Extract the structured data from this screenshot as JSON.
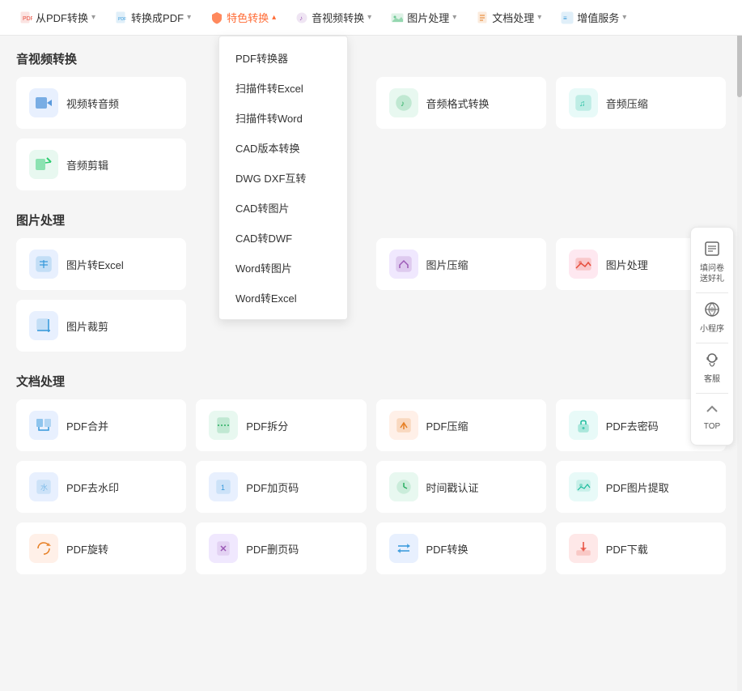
{
  "nav": {
    "items": [
      {
        "id": "from-pdf",
        "label": "从PDF转换",
        "icon": "📄",
        "hasArrow": true,
        "arrowDir": "down"
      },
      {
        "id": "to-pdf",
        "label": "转换成PDF",
        "icon": "📋",
        "hasArrow": true,
        "arrowDir": "down"
      },
      {
        "id": "special",
        "label": "特色转换",
        "icon": "🛡️",
        "hasArrow": true,
        "arrowDir": "up",
        "active": true
      },
      {
        "id": "audio-video",
        "label": "音视频转换",
        "icon": "🎵",
        "hasArrow": true,
        "arrowDir": "down"
      },
      {
        "id": "image",
        "label": "图片处理",
        "icon": "🖼️",
        "hasArrow": true,
        "arrowDir": "down"
      },
      {
        "id": "doc",
        "label": "文档处理",
        "icon": "📝",
        "hasArrow": true,
        "arrowDir": "down"
      },
      {
        "id": "value-added",
        "label": "增值服务",
        "icon": "✨",
        "hasArrow": true,
        "arrowDir": "down"
      }
    ]
  },
  "dropdown": {
    "items": [
      {
        "label": "PDF转换器"
      },
      {
        "label": "扫描件转Excel"
      },
      {
        "label": "扫描件转Word"
      },
      {
        "label": "CAD版本转换"
      },
      {
        "label": "DWG DXF互转"
      },
      {
        "label": "CAD转图片"
      },
      {
        "label": "CAD转DWF"
      },
      {
        "label": "Word转图片"
      },
      {
        "label": "Word转Excel"
      }
    ]
  },
  "sections": [
    {
      "id": "audio-video-section",
      "title": "音视频转换",
      "tools": [
        {
          "id": "video-to-audio",
          "name": "视频转音频",
          "iconColor": "icon-blue-light",
          "iconChar": "🎬"
        },
        {
          "id": "audio-format",
          "name": "音频格式转换",
          "iconColor": "icon-green-light",
          "iconChar": "🎵"
        },
        {
          "id": "audio-compress",
          "name": "音频压缩",
          "iconColor": "icon-teal-light",
          "iconChar": "🎶"
        },
        {
          "id": "empty1",
          "name": "",
          "hidden": true
        }
      ],
      "row2": [
        {
          "id": "audio-edit",
          "name": "音频剪辑",
          "iconColor": "icon-green-light",
          "iconChar": "✂️"
        },
        {
          "id": "empty2",
          "name": "",
          "hidden": true
        },
        {
          "id": "empty3",
          "name": "",
          "hidden": true
        },
        {
          "id": "empty4",
          "name": "",
          "hidden": true
        }
      ]
    },
    {
      "id": "image-section",
      "title": "图片处理",
      "tools": [
        {
          "id": "img-to-excel",
          "name": "图片转Excel",
          "iconColor": "icon-blue-light",
          "iconChar": "📊"
        },
        {
          "id": "img-compress",
          "name": "图片压缩",
          "iconColor": "icon-purple-light",
          "iconChar": "🗜️"
        },
        {
          "id": "img-process",
          "name": "图片处理",
          "iconColor": "icon-pink-light",
          "iconChar": "🖼️"
        },
        {
          "id": "empty5",
          "name": "",
          "hidden": true
        }
      ],
      "row2": [
        {
          "id": "img-crop",
          "name": "图片裁剪",
          "iconColor": "icon-blue-light",
          "iconChar": "✂️"
        },
        {
          "id": "empty6",
          "name": "",
          "hidden": true
        },
        {
          "id": "empty7",
          "name": "",
          "hidden": true
        },
        {
          "id": "empty8",
          "name": "",
          "hidden": true
        }
      ]
    },
    {
      "id": "doc-section",
      "title": "文档处理",
      "tools": [
        {
          "id": "pdf-merge",
          "name": "PDF合并",
          "iconColor": "icon-blue-light",
          "iconChar": "📑"
        },
        {
          "id": "pdf-split",
          "name": "PDF拆分",
          "iconColor": "icon-green-light",
          "iconChar": "📄"
        },
        {
          "id": "pdf-compress",
          "name": "PDF压缩",
          "iconColor": "icon-orange-light",
          "iconChar": "📦"
        },
        {
          "id": "pdf-decrypt",
          "name": "PDF去密码",
          "iconColor": "icon-teal-light",
          "iconChar": "🔓"
        }
      ],
      "row2": [
        {
          "id": "pdf-watermark",
          "name": "PDF去水印",
          "iconColor": "icon-blue-light",
          "iconChar": "💧"
        },
        {
          "id": "pdf-page-num",
          "name": "PDF加页码",
          "iconColor": "icon-blue-light",
          "iconChar": "🔢"
        },
        {
          "id": "time-cert",
          "name": "时间戳认证",
          "iconColor": "icon-green-light",
          "iconChar": "⏰"
        },
        {
          "id": "pdf-img-extract",
          "name": "PDF图片提取",
          "iconColor": "icon-teal-light",
          "iconChar": "🖼️"
        }
      ],
      "row3": [
        {
          "id": "pdf-rotate",
          "name": "PDF旋转",
          "iconColor": "icon-orange-light",
          "iconChar": "🔄"
        },
        {
          "id": "pdf-page-del",
          "name": "PDF删页码",
          "iconColor": "icon-purple-light",
          "iconChar": "🗑️"
        },
        {
          "id": "pdf-convert",
          "name": "PDF转换",
          "iconColor": "icon-blue-light",
          "iconChar": "🔁"
        },
        {
          "id": "pdf-dl",
          "name": "PDF下载",
          "iconColor": "icon-red-light",
          "iconChar": "⬇️"
        }
      ]
    }
  ],
  "float_panel": {
    "survey": "填问卷\n送好礼",
    "mini_program": "小程序",
    "customer_service": "客服",
    "top": "TOP"
  }
}
